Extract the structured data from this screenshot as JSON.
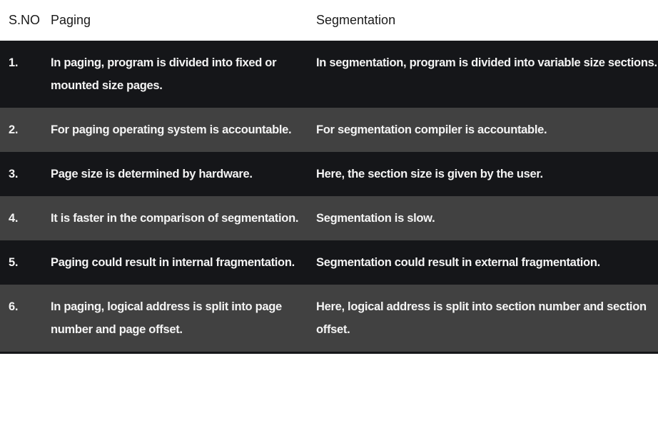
{
  "headers": {
    "sno": "S.NO",
    "paging": "Paging",
    "segmentation": "Segmentation"
  },
  "rows": [
    {
      "sno": "1.",
      "paging": "In paging, program is divided into fixed or mounted size pages.",
      "segmentation": "In segmentation, program is divided into variable size sections."
    },
    {
      "sno": "2.",
      "paging": "For paging operating system is accountable.",
      "segmentation": "For segmentation compiler is accountable."
    },
    {
      "sno": "3.",
      "paging": "Page size is determined by hardware.",
      "segmentation": "Here, the section size is given by the user."
    },
    {
      "sno": "4.",
      "paging": "It is faster in the comparison of segmentation.",
      "segmentation": "Segmentation is slow."
    },
    {
      "sno": "5.",
      "paging": "Paging could result in internal fragmentation.",
      "segmentation": "Segmentation could result in external fragmentation."
    },
    {
      "sno": "6.",
      "paging": "In paging, logical address is split into page number and page offset.",
      "segmentation": "Here, logical address is split into section number and section offset."
    }
  ],
  "colors": {
    "dark_row": "#151619",
    "light_row": "#414141",
    "header_bg": "#ffffff"
  }
}
